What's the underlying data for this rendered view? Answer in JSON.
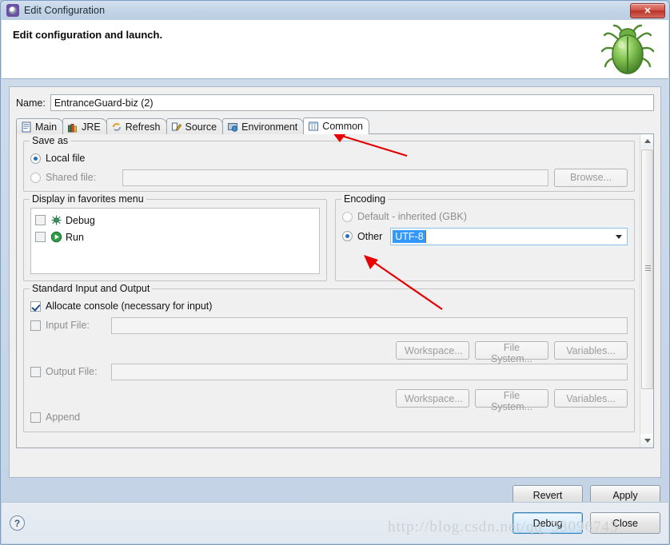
{
  "window": {
    "title": "Edit Configuration",
    "title_icon": "launch-config-icon",
    "close_label": "✕"
  },
  "banner": {
    "title": "Edit configuration and launch.",
    "image": "green-bug-icon"
  },
  "name_field": {
    "label": "Name:",
    "value": "EntranceGuard-biz (2)"
  },
  "tabs": [
    {
      "label": "Main",
      "icon": "document-icon",
      "active": false
    },
    {
      "label": "JRE",
      "icon": "books-icon",
      "active": false
    },
    {
      "label": "Refresh",
      "icon": "refresh-arrows-icon",
      "active": false
    },
    {
      "label": "Source",
      "icon": "source-pencil-icon",
      "active": false
    },
    {
      "label": "Environment",
      "icon": "environment-icon",
      "active": false
    },
    {
      "label": "Common",
      "icon": "common-window-icon",
      "active": true
    }
  ],
  "save_as": {
    "legend": "Save as",
    "local_file": {
      "label": "Local file",
      "selected": true
    },
    "shared_file": {
      "label": "Shared file:",
      "selected": false,
      "value": ""
    },
    "browse_button": "Browse..."
  },
  "favorites": {
    "legend": "Display in favorites menu",
    "items": [
      {
        "label": "Debug",
        "icon": "debug-bug-icon",
        "checked": false
      },
      {
        "label": "Run",
        "icon": "run-play-icon",
        "checked": false
      }
    ]
  },
  "encoding": {
    "legend": "Encoding",
    "default_option": {
      "label": "Default - inherited (GBK)",
      "selected": false
    },
    "other_option": {
      "label": "Other",
      "selected": true
    },
    "other_value": "UTF-8"
  },
  "stdio": {
    "legend": "Standard Input and Output",
    "allocate_console": {
      "label": "Allocate console (necessary for input)",
      "checked": true
    },
    "input_file": {
      "label": "Input File:",
      "checked": false,
      "value": ""
    },
    "input_buttons": [
      "Workspace...",
      "File System...",
      "Variables..."
    ],
    "output_file": {
      "label": "Output File:",
      "checked": false,
      "value": ""
    },
    "output_buttons": [
      "Workspace...",
      "File System...",
      "Variables..."
    ],
    "append": {
      "label": "Append",
      "checked": false
    }
  },
  "actions": {
    "revert": "Revert",
    "apply": "Apply",
    "debug": "Debug",
    "close": "Close",
    "help": "?"
  },
  "watermark": "http://blog.csdn.net/qq_33096743",
  "colors": {
    "accent": "#3399ff",
    "title_bar": "#c2d3e6",
    "default_button_border": "#3c7fb1",
    "annotation_arrow": "#e60000"
  }
}
